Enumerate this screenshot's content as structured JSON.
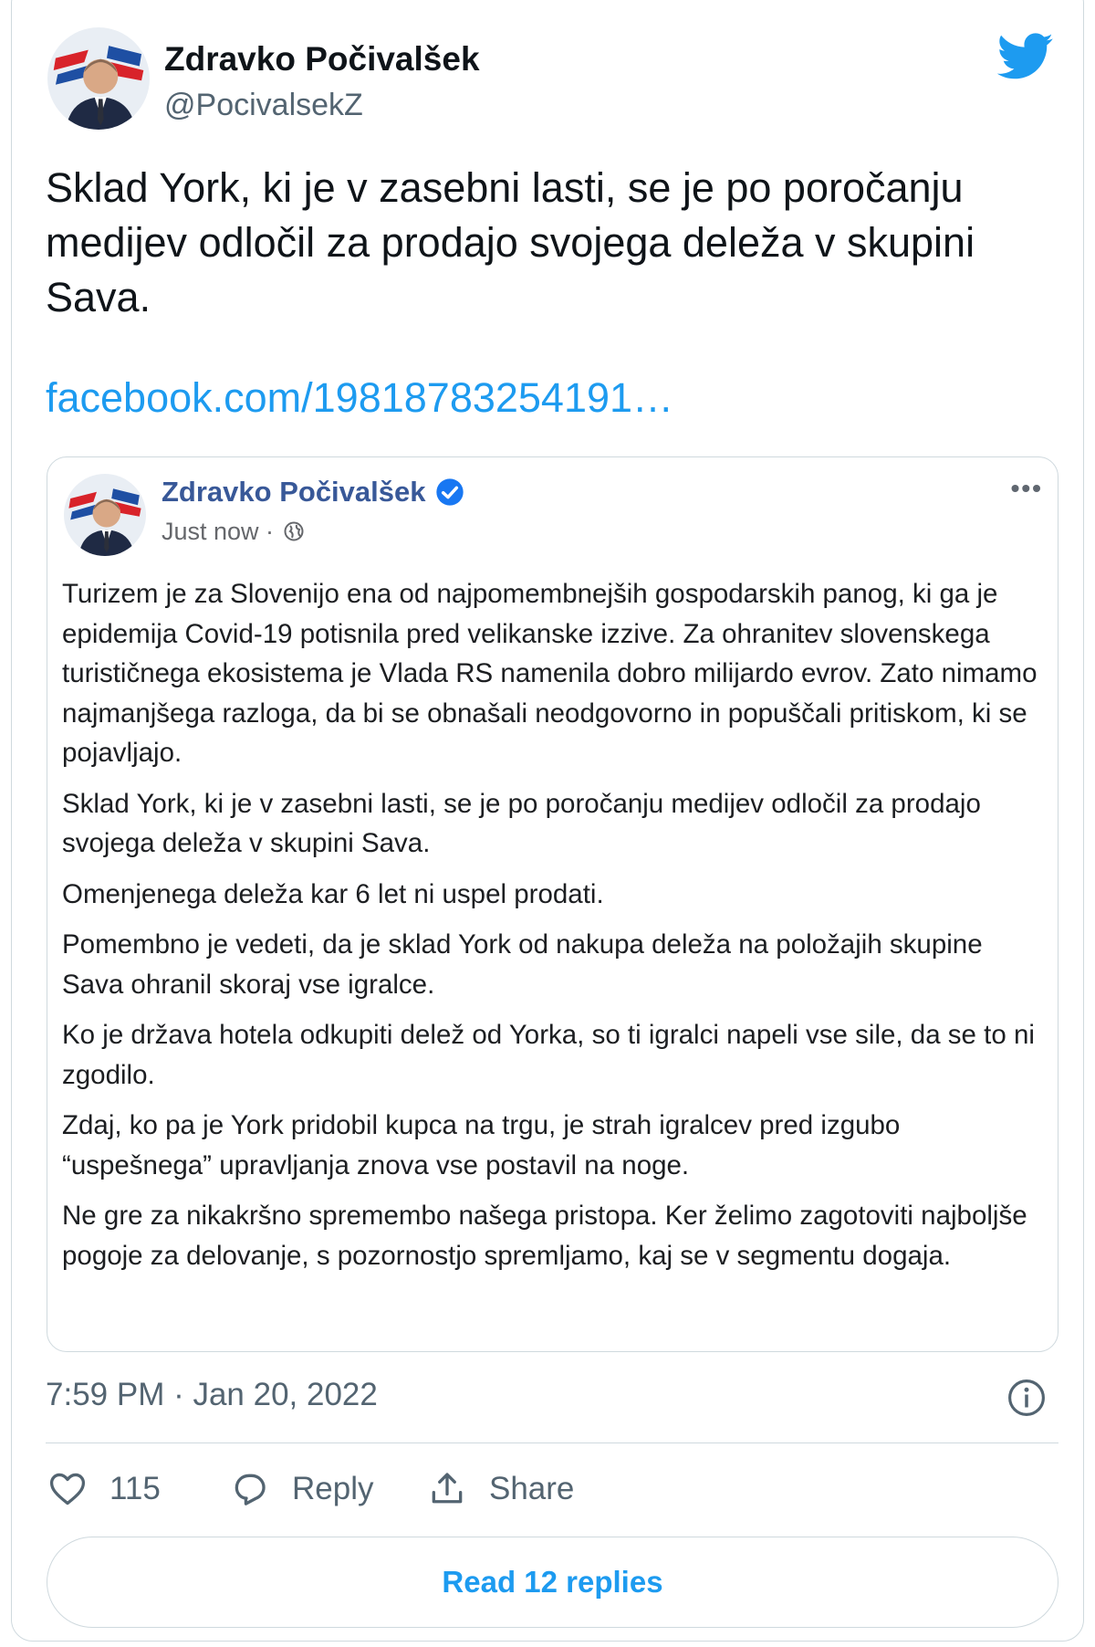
{
  "tweet": {
    "author": {
      "name": "Zdravko Počivalšek",
      "handle": "@PocivalsekZ"
    },
    "text": "Sklad York, ki je v zasebni lasti, se je po poročanju medijev odločil za prodajo svojega deleža v skupini Sava.",
    "link": "facebook.com/19818783254191…",
    "timestamp": "7:59 PM · Jan 20, 2022",
    "actions": {
      "likes": "115",
      "reply_label": "Reply",
      "share_label": "Share"
    },
    "read_replies": "Read 12 replies"
  },
  "quoted_post": {
    "author": "Zdravko Počivalšek",
    "time": "Just now ·",
    "more": "•••",
    "paragraphs": [
      "Turizem je za Slovenijo ena od najpomembnejših gospodarskih panog, ki ga je epidemija Covid-19 potisnila pred velikanske izzive. Za ohranitev slovenskega turističnega ekosistema je Vlada RS namenila dobro milijardo evrov. Zato nimamo najmanjšega razloga, da bi se obnašali neodgovorno in popuščali pritiskom, ki se pojavljajo.",
      "Sklad York, ki je v zasebni lasti, se je po poročanju medijev odločil za prodajo svojega deleža v skupini Sava.",
      "Omenjenega deleža kar 6 let ni uspel prodati.",
      "Pomembno je vedeti, da je sklad York od nakupa deleža na položajih skupine Sava ohranil skoraj vse igralce.",
      "Ko je država hotela odkupiti delež od Yorka, so ti igralci napeli vse sile, da se to ni zgodilo.",
      "Zdaj, ko pa je York pridobil kupca na trgu, je strah igralcev pred izgubo “uspešnega” upravljanja znova vse postavil na noge.",
      "Ne gre za nikakršno spremembo našega pristopa. Ker želimo zagotoviti najboljše pogoje za delovanje, s pozornostjo spremljamo, kaj se v segmentu dogaja."
    ]
  },
  "colors": {
    "accent": "#1d9bf0",
    "fb_name": "#385898",
    "muted": "#536471",
    "border": "#cfd9de"
  },
  "icons": [
    "twitter-bird-icon",
    "verified-icon",
    "globe-icon",
    "info-icon",
    "heart-icon",
    "reply-icon",
    "share-icon"
  ]
}
